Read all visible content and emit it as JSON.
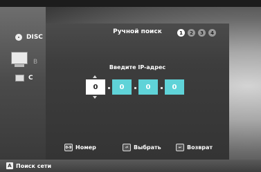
{
  "sidebar": {
    "items": [
      {
        "label": "DISC",
        "icon": "disc-icon"
      },
      {
        "label": "B",
        "icon": "pc-icon"
      },
      {
        "label": "C",
        "icon": "pc-icon"
      }
    ]
  },
  "dialog": {
    "title": "Ручной поиск",
    "steps": [
      "1",
      "2",
      "3",
      "4"
    ],
    "active_step": "1",
    "prompt": "Введите IP-адрес",
    "ip_octets": [
      "0",
      "0",
      "0",
      "0"
    ]
  },
  "footer": {
    "buttons": [
      {
        "icon": "number-keys-icon",
        "icon_text": "0-9",
        "label": "Номер"
      },
      {
        "icon": "enter-icon",
        "icon_text": "⏎",
        "label": "Выбрать"
      },
      {
        "icon": "return-icon",
        "icon_text": "↩",
        "label": "Возврат"
      }
    ]
  },
  "bottom_bar": {
    "badge": "A",
    "label": "Поиск сети"
  }
}
